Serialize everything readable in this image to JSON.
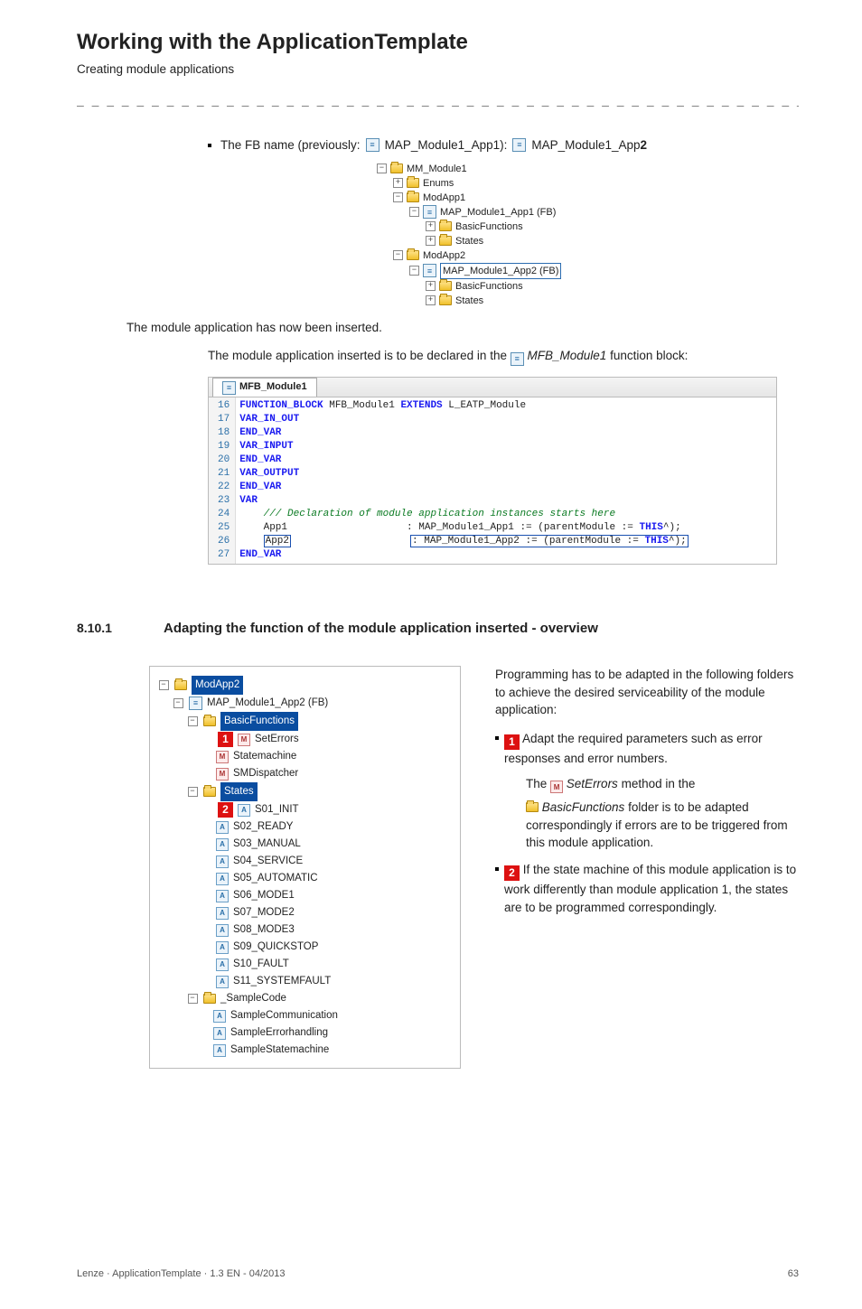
{
  "header": {
    "title": "Working with the ApplicationTemplate",
    "subtitle": "Creating module applications",
    "separator": "_ _ _ _ _ _ _ _ _ _ _ _ _ _ _ _ _ _ _ _ _ _ _ _ _ _ _ _ _ _ _ _ _ _ _ _ _ _ _ _ _ _ _ _ _ _ _ _ _ _ _ _ _ _ _ _ _ _ _ _ _ _ _ _"
  },
  "fb_line": {
    "prefix": "The FB name (previously:",
    "old_name": "MAP_Module1_App1):",
    "new_name_a": "MAP_Module1_App",
    "new_name_b": "2"
  },
  "tree1": {
    "n0": "MM_Module1",
    "n1": "Enums",
    "n2": "ModApp1",
    "n3": "MAP_Module1_App1 (FB)",
    "n4": "BasicFunctions",
    "n5": "States",
    "n6": "ModApp2",
    "n7": "MAP_Module1_App2 (FB)",
    "n8": "BasicFunctions",
    "n9": "States"
  },
  "para1": "The module application has now been inserted.",
  "para2a": "The module application inserted is to be declared in the",
  "para2b": "MFB_Module1",
  "para2c": "function block:",
  "code": {
    "tab": "MFB_Module1",
    "gut": [
      "16",
      "17",
      "18",
      "19",
      "20",
      "21",
      "22",
      "23",
      "24",
      "25",
      "26",
      "27"
    ],
    "l16a": "FUNCTION_BLOCK",
    "l16b": " MFB_Module1 ",
    "l16c": "EXTENDS",
    "l16d": " L_EATP_Module",
    "l17": "VAR_IN_OUT",
    "l18": "END_VAR",
    "l19": "VAR_INPUT",
    "l20": "END_VAR",
    "l21": "VAR_OUTPUT",
    "l22": "END_VAR",
    "l23": "VAR",
    "l24": "    /// Declaration of module application instances starts here",
    "l25a": "    App1                    : MAP_Module1_App1 := (parentModule := ",
    "l25b": "THIS",
    "l25c": "^);",
    "l26a": "    ",
    "l26b": "App2",
    "l26c": "                    ",
    "l26d": ": MAP_Module1_App2 := (parentModule := ",
    "l26e": "THIS",
    "l26f": "^);",
    "l27": "END_VAR"
  },
  "section": {
    "num": "8.10.1",
    "title": "Adapting the function of the module application inserted - overview"
  },
  "tree2": {
    "root": "ModApp2",
    "fb": "MAP_Module1_App2 (FB)",
    "basic": "BasicFunctions",
    "b1": "SetErrors",
    "b2": "Statemachine",
    "b3": "SMDispatcher",
    "states": "States",
    "s1": "S01_INIT",
    "s2": "S02_READY",
    "s3": "S03_MANUAL",
    "s4": "S04_SERVICE",
    "s5": "S05_AUTOMATIC",
    "s6": "S06_MODE1",
    "s7": "S07_MODE2",
    "s8": "S08_MODE3",
    "s9": "S09_QUICKSTOP",
    "s10": "S10_FAULT",
    "s11": "S11_SYSTEMFAULT",
    "sample": "_SampleCode",
    "sc1": "SampleCommunication",
    "sc2": "SampleErrorhandling",
    "sc3": "SampleStatemachine"
  },
  "right": {
    "p1": "Programming has to be adapted in the following folders to achieve the desired serviceability of the module application:",
    "b1": "Adapt the required parameters such as error responses and error numbers.",
    "sub_a": "The",
    "sub_b": "SetErrors",
    "sub_c": "method in the",
    "sub_d": "BasicFunctions",
    "sub_e": "folder is to be adapted correspondingly if errors are to be triggered from this module application.",
    "b2": "If the state machine of this module application is to work differently than module application 1, the states are to be programmed correspondingly."
  },
  "footer": {
    "left": "Lenze · ApplicationTemplate · 1.3 EN - 04/2013",
    "right": "63"
  },
  "badges": {
    "one": "1",
    "two": "2"
  },
  "glyphs": {
    "minus": "−",
    "plus": "+",
    "fb": "≡",
    "m": "M",
    "a": "A"
  }
}
